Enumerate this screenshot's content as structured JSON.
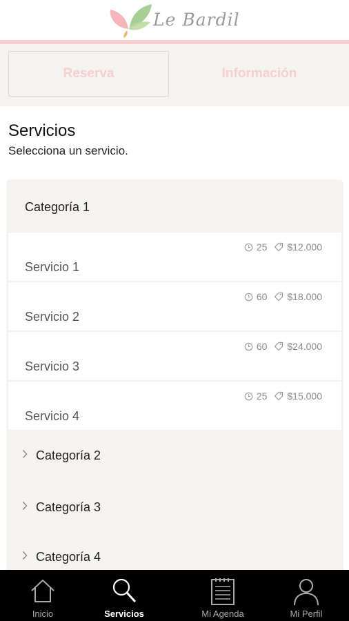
{
  "header": {
    "logo_text": "Le Bardil"
  },
  "tabs": [
    {
      "label": "Reserva"
    },
    {
      "label": "Información"
    }
  ],
  "section": {
    "title": "Servicios",
    "subtitle": "Selecciona un servicio."
  },
  "categories": {
    "expanded": {
      "label": "Categoría 1",
      "services": [
        {
          "name": "Servicio 1",
          "duration": "25",
          "price": "$12.000"
        },
        {
          "name": "Servicio 2",
          "duration": "60",
          "price": "$18.000"
        },
        {
          "name": "Servicio 3",
          "duration": "60",
          "price": "$24.000"
        },
        {
          "name": "Servicio 4",
          "duration": "25",
          "price": "$15.000"
        }
      ]
    },
    "collapsed": [
      {
        "label": "Categoría 2"
      },
      {
        "label": "Categoría 3"
      },
      {
        "label": "Categoría 4"
      }
    ]
  },
  "bottom_nav": [
    {
      "label": "Inicio",
      "icon": "home-icon"
    },
    {
      "label": "Servicios",
      "icon": "search-icon",
      "active": true
    },
    {
      "label": "Mi Agenda",
      "icon": "agenda-icon"
    },
    {
      "label": "Mi Perfil",
      "icon": "profile-icon"
    }
  ],
  "colors": {
    "accent_pink": "#f8cfd0",
    "panel": "#f4f3f0",
    "nav_bg": "#000000"
  }
}
